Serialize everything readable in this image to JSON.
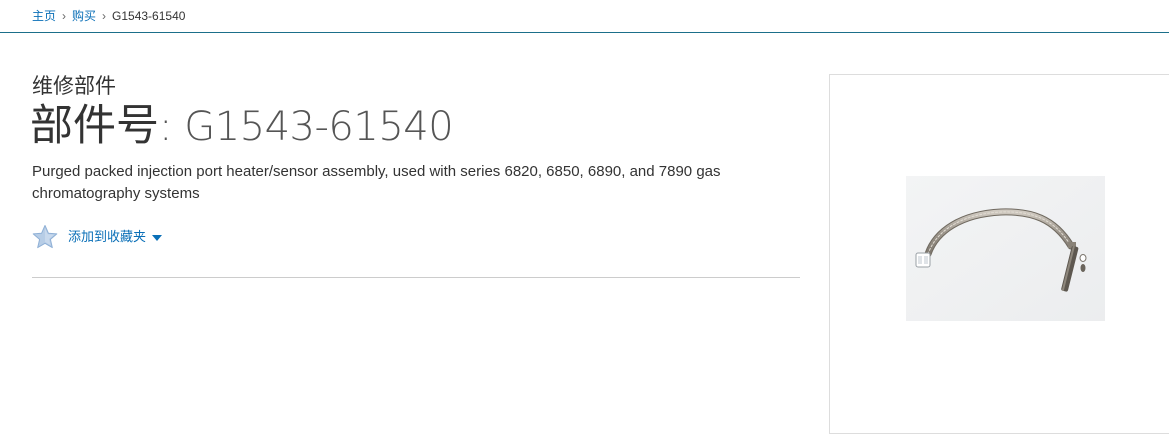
{
  "breadcrumb": {
    "home": "主页",
    "buy": "购买",
    "current": "G1543-61540",
    "separator": "›"
  },
  "product": {
    "category": "维修部件",
    "part_label": "部件号",
    "part_number": ": G1543-61540",
    "description": "Purged packed injection port heater/sensor assembly, used with series 6820, 6850, 6890, and 7890 gas chromatography systems",
    "favorite_label": "添加到收藏夹"
  },
  "colors": {
    "link": "#0a6fb7",
    "header_rule": "#1b6f8a",
    "star": "#a9c3e0"
  },
  "icons": {
    "favorite": "star-icon",
    "dropdown": "caret-down-icon"
  }
}
